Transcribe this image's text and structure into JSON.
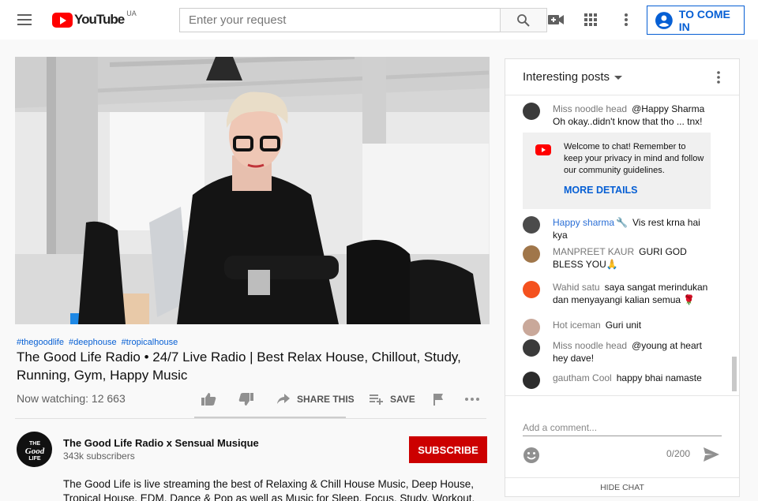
{
  "header": {
    "logo_text": "YouTube",
    "region": "UA",
    "search_placeholder": "Enter your request",
    "sign_in_label": "TO COME IN",
    "brand_color": "#ff0000",
    "accent_color": "#065fd4"
  },
  "video": {
    "hashtags": [
      "#thegoodlife",
      "#deephouse",
      "#tropicalhouse"
    ],
    "title": "The Good Life Radio • 24/7 Live Radio | Best Relax House, Chillout, Study, Running, Gym, Happy Music",
    "views": "Now watching: 12 663",
    "share_label": "SHARE THIS",
    "save_label": "SAVE"
  },
  "channel": {
    "name": "The Good Life Radio x Sensual Musique",
    "subscribers": "343k subscribers",
    "subscribe_label": "SUBSCRIBE",
    "description": "The Good Life is live streaming the best of Relaxing & Chill House Music, Deep House, Tropical House, EDM, Dance & Pop as well as Music for Sleep, Focus, Study, Workout, Gym"
  },
  "chat": {
    "title": "Interesting posts",
    "messages": [
      {
        "author": "Miss noodle head",
        "text": "@Happy Sharma Oh okay..didn't know that tho ... tnx!"
      },
      {
        "author": "Happy sharma",
        "badge": "🔧",
        "text": "Vis rest krna hai kya"
      },
      {
        "author": "MANPREET KAUR",
        "text": "GURI GOD BLESS YOU🙏"
      },
      {
        "author": "Wahid satu",
        "text": "saya sangat merindukan dan menyayangi kalian semua 🌹"
      },
      {
        "author": "Hot iceman",
        "text": "Guri unit"
      },
      {
        "author": "Miss noodle head",
        "text": "@young at heart hey dave!"
      },
      {
        "author": "gautham Cool",
        "text": "happy bhai namaste"
      }
    ],
    "welcome_text": "Welcome to chat! Remember to keep your privacy in mind and follow our community guidelines.",
    "welcome_link": "MORE DETAILS",
    "input_placeholder": "Add a comment...",
    "char_count": "0/200",
    "hide_label": "HIDE CHAT"
  }
}
